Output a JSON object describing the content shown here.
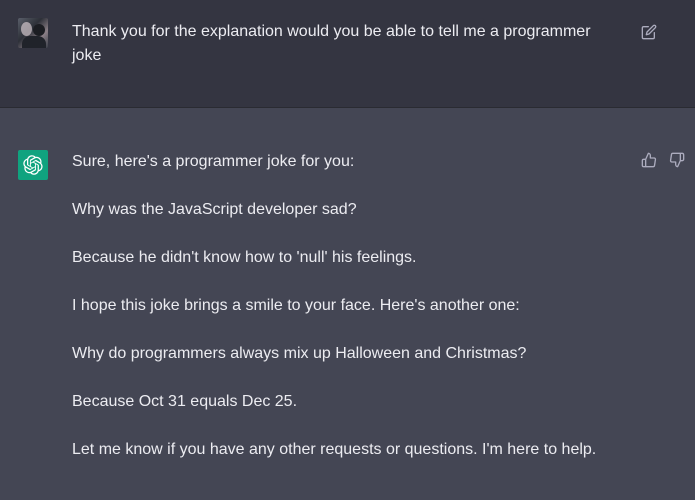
{
  "user_message": {
    "avatar_icon": "user-photo-avatar",
    "text": "Thank you for the explanation would you be able to tell me a programmer joke",
    "edit_icon": "edit-icon"
  },
  "assistant_message": {
    "avatar_icon": "chatgpt-logo-icon",
    "avatar_color": "#10a37f",
    "paragraphs": [
      "Sure, here's a programmer joke for you:",
      "Why was the JavaScript developer sad?",
      "Because he didn't know how to 'null' his feelings.",
      "I hope this joke brings a smile to your face. Here's another one:",
      "Why do programmers always mix up Halloween and Christmas?",
      "Because Oct 31 equals Dec 25.",
      "Let me know if you have any other requests or questions. I'm here to help."
    ],
    "feedback_icons": [
      "thumbs-up-icon",
      "thumbs-down-icon"
    ]
  },
  "colors": {
    "user_background": "#343541",
    "assistant_background": "#444654",
    "text": "#ececf1",
    "icon": "#acacbe"
  }
}
